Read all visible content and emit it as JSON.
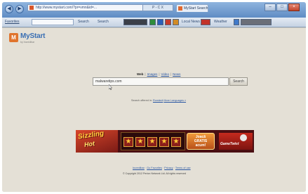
{
  "browser": {
    "url": "http://www.mystart.com/?pr=vmn&id=...",
    "controls": "P - C X",
    "tab_title": "MyStart Search",
    "window_buttons": [
      "–",
      "□",
      "×"
    ],
    "toolbar_items": [
      "Favorites",
      "Search",
      "Search",
      "Local News",
      "Weather"
    ],
    "colors": {
      "titlebar": "#6b97cc",
      "toolbar": "#d4dfec",
      "page_bg": "#e4e0d6",
      "link": "#2a57a3"
    }
  },
  "logo": {
    "icon_letter": "M",
    "name": "MyStart",
    "tagline": "by Incredibar"
  },
  "search": {
    "tabs": [
      {
        "label": "Web",
        "active": true
      },
      {
        "label": "Images",
        "active": false
      },
      {
        "label": "Video",
        "active": false
      },
      {
        "label": "News",
        "active": false
      }
    ],
    "query": "malwaretips.com",
    "button_label": "Search",
    "offered_prefix": "Search offered in:",
    "offered_language": "Română",
    "more_languages": "More Languages »"
  },
  "banner": {
    "title_line1": "Sizzling",
    "title_line2": "Hot",
    "cta": [
      "Joacă",
      "GRATIS",
      "acum!"
    ],
    "brand": "GameTwist",
    "star_glyph": "★"
  },
  "footer": {
    "links": [
      "Incredibar",
      "Go Favorites",
      "Privacy",
      "Terms of use"
    ],
    "copyright": "© Copyright 2012 Perion Network Ltd. All rights reserved"
  }
}
